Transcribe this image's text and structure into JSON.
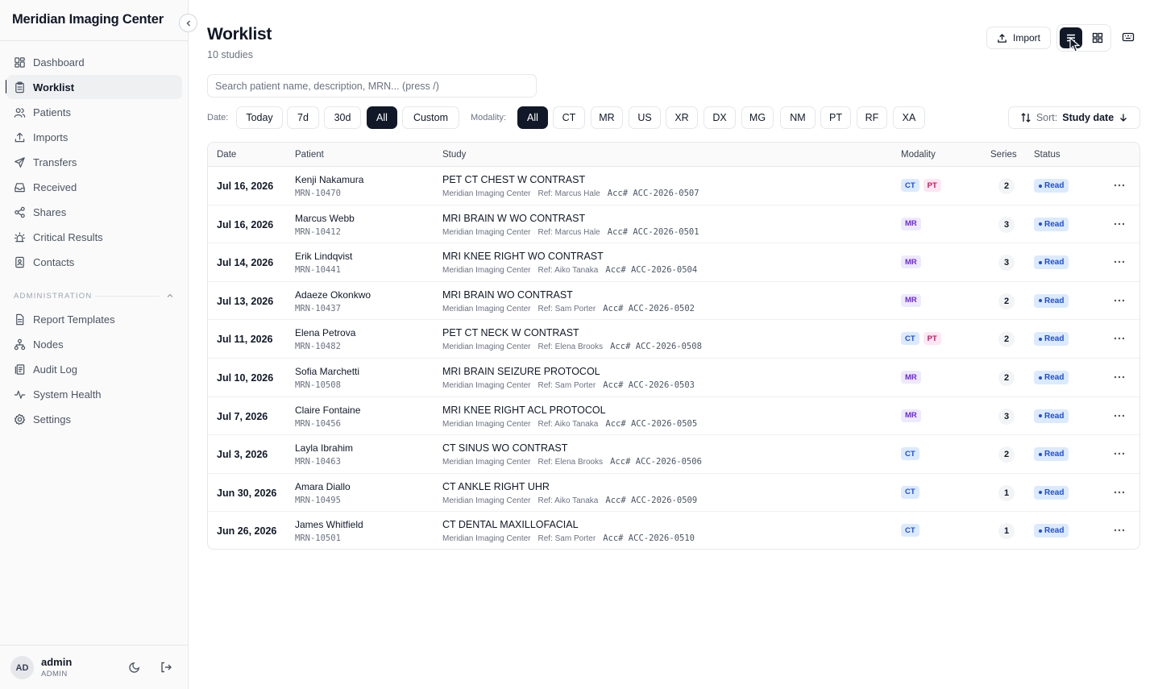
{
  "app": {
    "name": "Meridian Imaging Center"
  },
  "nav": [
    {
      "label": "Dashboard",
      "icon": "dashboard-icon"
    },
    {
      "label": "Worklist",
      "icon": "clipboard-icon",
      "active": true
    },
    {
      "label": "Patients",
      "icon": "users-icon"
    },
    {
      "label": "Imports",
      "icon": "upload-icon"
    },
    {
      "label": "Transfers",
      "icon": "send-icon"
    },
    {
      "label": "Received",
      "icon": "inbox-icon"
    },
    {
      "label": "Shares",
      "icon": "share-icon"
    },
    {
      "label": "Critical Results",
      "icon": "siren-icon"
    },
    {
      "label": "Contacts",
      "icon": "contact-book-icon"
    }
  ],
  "admin_section": {
    "title": "ADMINISTRATION",
    "items": [
      {
        "label": "Report Templates",
        "icon": "file-icon"
      },
      {
        "label": "Nodes",
        "icon": "network-icon"
      },
      {
        "label": "Audit Log",
        "icon": "log-icon"
      },
      {
        "label": "System Health",
        "icon": "pulse-icon"
      },
      {
        "label": "Settings",
        "icon": "gear-icon"
      }
    ]
  },
  "user": {
    "initials": "AD",
    "name": "admin",
    "role": "ADMIN"
  },
  "header": {
    "title": "Worklist",
    "subtitle": "10 studies",
    "import_label": "Import"
  },
  "search": {
    "placeholder": "Search patient name, description, MRN... (press /)"
  },
  "filters": {
    "date_label": "Date:",
    "date_options": [
      "Today",
      "7d",
      "30d",
      "All",
      "Custom"
    ],
    "date_selected": "All",
    "modality_label": "Modality:",
    "modality_options": [
      "All",
      "CT",
      "MR",
      "US",
      "XR",
      "DX",
      "MG",
      "NM",
      "PT",
      "RF",
      "XA"
    ],
    "modality_selected": "All"
  },
  "sort": {
    "label": "Sort:",
    "value": "Study date"
  },
  "table": {
    "columns": [
      "Date",
      "Patient",
      "Study",
      "Modality",
      "Series",
      "Status"
    ],
    "rows": [
      {
        "date": "Jul 16, 2026",
        "patient": "Kenji Nakamura",
        "mrn": "MRN-10470",
        "study": "PET CT CHEST W CONTRAST",
        "site": "Meridian Imaging Center",
        "ref": "Ref: Marcus Hale",
        "acc": "Acc# ACC-2026-0507",
        "modalities": [
          "CT",
          "PT"
        ],
        "series": "2",
        "status": "Read"
      },
      {
        "date": "Jul 16, 2026",
        "patient": "Marcus Webb",
        "mrn": "MRN-10412",
        "study": "MRI BRAIN W WO CONTRAST",
        "site": "Meridian Imaging Center",
        "ref": "Ref: Marcus Hale",
        "acc": "Acc# ACC-2026-0501",
        "modalities": [
          "MR"
        ],
        "series": "3",
        "status": "Read"
      },
      {
        "date": "Jul 14, 2026",
        "patient": "Erik Lindqvist",
        "mrn": "MRN-10441",
        "study": "MRI KNEE RIGHT WO CONTRAST",
        "site": "Meridian Imaging Center",
        "ref": "Ref: Aiko Tanaka",
        "acc": "Acc# ACC-2026-0504",
        "modalities": [
          "MR"
        ],
        "series": "3",
        "status": "Read"
      },
      {
        "date": "Jul 13, 2026",
        "patient": "Adaeze Okonkwo",
        "mrn": "MRN-10437",
        "study": "MRI BRAIN WO CONTRAST",
        "site": "Meridian Imaging Center",
        "ref": "Ref: Sam Porter",
        "acc": "Acc# ACC-2026-0502",
        "modalities": [
          "MR"
        ],
        "series": "2",
        "status": "Read"
      },
      {
        "date": "Jul 11, 2026",
        "patient": "Elena Petrova",
        "mrn": "MRN-10482",
        "study": "PET CT NECK W CONTRAST",
        "site": "Meridian Imaging Center",
        "ref": "Ref: Elena Brooks",
        "acc": "Acc# ACC-2026-0508",
        "modalities": [
          "CT",
          "PT"
        ],
        "series": "2",
        "status": "Read"
      },
      {
        "date": "Jul 10, 2026",
        "patient": "Sofia Marchetti",
        "mrn": "MRN-10508",
        "study": "MRI BRAIN SEIZURE PROTOCOL",
        "site": "Meridian Imaging Center",
        "ref": "Ref: Sam Porter",
        "acc": "Acc# ACC-2026-0503",
        "modalities": [
          "MR"
        ],
        "series": "2",
        "status": "Read"
      },
      {
        "date": "Jul 7, 2026",
        "patient": "Claire Fontaine",
        "mrn": "MRN-10456",
        "study": "MRI KNEE RIGHT ACL PROTOCOL",
        "site": "Meridian Imaging Center",
        "ref": "Ref: Aiko Tanaka",
        "acc": "Acc# ACC-2026-0505",
        "modalities": [
          "MR"
        ],
        "series": "3",
        "status": "Read"
      },
      {
        "date": "Jul 3, 2026",
        "patient": "Layla Ibrahim",
        "mrn": "MRN-10463",
        "study": "CT SINUS WO CONTRAST",
        "site": "Meridian Imaging Center",
        "ref": "Ref: Elena Brooks",
        "acc": "Acc# ACC-2026-0506",
        "modalities": [
          "CT"
        ],
        "series": "2",
        "status": "Read"
      },
      {
        "date": "Jun 30, 2026",
        "patient": "Amara Diallo",
        "mrn": "MRN-10495",
        "study": "CT ANKLE RIGHT UHR",
        "site": "Meridian Imaging Center",
        "ref": "Ref: Aiko Tanaka",
        "acc": "Acc# ACC-2026-0509",
        "modalities": [
          "CT"
        ],
        "series": "1",
        "status": "Read"
      },
      {
        "date": "Jun 26, 2026",
        "patient": "James Whitfield",
        "mrn": "MRN-10501",
        "study": "CT DENTAL MAXILLOFACIAL",
        "site": "Meridian Imaging Center",
        "ref": "Ref: Sam Porter",
        "acc": "Acc# ACC-2026-0510",
        "modalities": [
          "CT"
        ],
        "series": "1",
        "status": "Read"
      }
    ]
  },
  "colors": {
    "accent": "#111827",
    "status_read_bg": "#dbeafe",
    "status_read_fg": "#1d4ed8",
    "ct_bg": "#dbeafe",
    "pt_bg": "#fce7f3",
    "mr_bg": "#ede9fe"
  }
}
